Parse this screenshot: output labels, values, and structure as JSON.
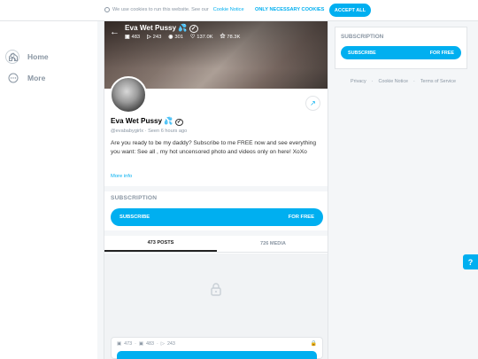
{
  "cookie_banner": {
    "text": "We use cookies to run this website. See our",
    "link": "Cookie Notice",
    "necessary_label": "ONLY NECESSARY COOKIES",
    "accept_label": "ACCEPT ALL"
  },
  "sidebar": {
    "items": [
      {
        "label": "Home",
        "icon": "home-icon"
      },
      {
        "label": "More",
        "icon": "more-icon"
      }
    ]
  },
  "profile": {
    "header_name": "Eva Wet Pussy 💦",
    "stats": {
      "photos": "483",
      "videos": "243",
      "streams": "301",
      "likes": "137.0K",
      "fans": "78.3K"
    },
    "name": "Eva Wet Pussy 💦",
    "handle": "@evababygirlx",
    "seen": "Seen  6 hours ago",
    "bio_line1": "Are you ready to be my daddy? Subscribe to me FREE now and see everything",
    "bio_line2": "you want: See all , my hot uncensored photo and videos only on here! XoXo",
    "more_info": "More info",
    "subscription_title": "SUBSCRIPTION",
    "subscribe_label": "SUBSCRIBE",
    "free_label": "FOR FREE",
    "tabs": [
      "473 POSTS",
      "726 MEDIA"
    ],
    "post_stats": {
      "posts": "473",
      "photos": "483",
      "videos": "243"
    }
  },
  "right_panel": {
    "subscription_title": "SUBSCRIPTION",
    "subscribe_label": "SUBSCRIBE",
    "free_label": "FOR FREE",
    "footer_links": [
      "Privacy",
      "Cookie Notice",
      "Terms of Service"
    ]
  },
  "help_label": "?",
  "colors": {
    "accent": "#00aff0",
    "muted": "#8a96a3",
    "background": "#f4f6f8"
  }
}
